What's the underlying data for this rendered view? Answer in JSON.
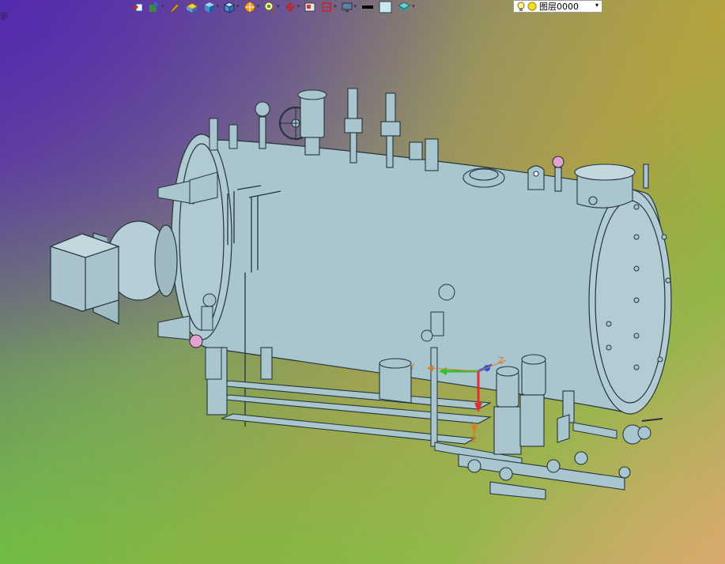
{
  "toolbar": {
    "items": [
      {
        "icon": "view-orient-icon",
        "dropdown": false
      },
      {
        "icon": "display-style-icon",
        "dropdown": true
      },
      {
        "icon": "edit-appearance-icon",
        "dropdown": false
      },
      {
        "icon": "section-view-icon",
        "dropdown": false
      },
      {
        "icon": "view-cube-icon",
        "dropdown": true
      },
      {
        "icon": "shaded-edges-icon",
        "dropdown": true
      },
      {
        "icon": "scene-icon",
        "dropdown": true
      },
      {
        "icon": "zoom-fit-icon",
        "dropdown": true
      },
      {
        "icon": "hide-show-icon",
        "dropdown": true
      },
      {
        "icon": "render-tools-icon",
        "dropdown": false
      },
      {
        "icon": "screen-capture-icon",
        "dropdown": true
      },
      {
        "icon": "monitor-icon",
        "dropdown": true
      },
      {
        "icon": "line-style-icon",
        "dropdown": false
      },
      {
        "icon": "color-swatch-icon",
        "dropdown": false
      },
      {
        "icon": "layer-stack-icon",
        "dropdown": true
      }
    ]
  },
  "layer": {
    "label": "图层0000",
    "icons": [
      "bulb-icon",
      "sun-icon"
    ]
  },
  "side_label": "示",
  "triad": {
    "x_label": "X",
    "y_label": "Y",
    "z_label": "Z",
    "z2_label": "Z",
    "colors": {
      "x": "#e03030",
      "y": "#30c030",
      "z": "#3050e0",
      "origin": "#d87a20"
    }
  },
  "model": {
    "fill": "#a8c4cc",
    "edge": "#2a3a40"
  }
}
